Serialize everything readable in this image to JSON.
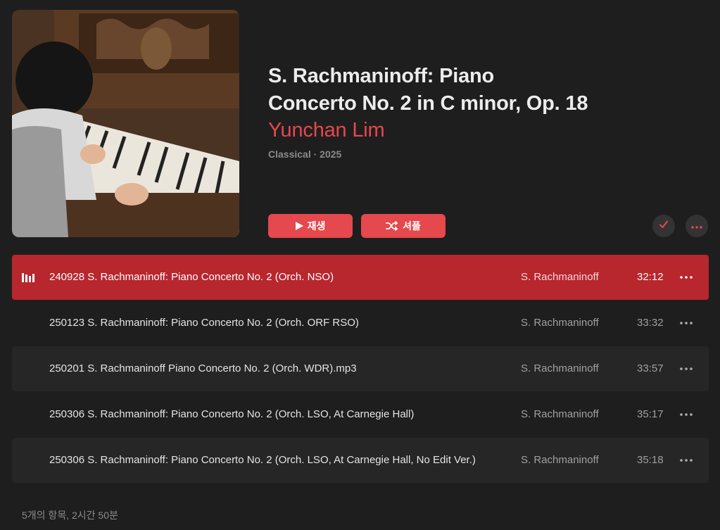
{
  "album": {
    "title_line1": "S. Rachmaninoff: Piano",
    "title_line2": "Concerto No. 2 in C minor, Op. 18",
    "artist": "Yunchan Lim",
    "meta": "Classical · 2025",
    "artwork_icon": "album-artwork-piano-photo"
  },
  "actions": {
    "play_label": "재생",
    "shuffle_label": "셔플",
    "play_icon": "play-icon",
    "shuffle_icon": "shuffle-icon",
    "check_icon": "checkmark-icon",
    "more_icon": "more-icon"
  },
  "tracks": [
    {
      "title": "240928 S. Rachmaninoff: Piano Concerto No. 2 (Orch. NSO)",
      "artist": "S. Rachmaninoff",
      "duration": "32:12",
      "playing": true
    },
    {
      "title": "250123 S. Rachmaninoff: Piano Concerto No. 2 (Orch. ORF RSO)",
      "artist": "S. Rachmaninoff",
      "duration": "33:32",
      "playing": false
    },
    {
      "title": "250201 S. Rachmaninoff Piano Concerto No. 2 (Orch. WDR).mp3",
      "artist": "S. Rachmaninoff",
      "duration": "33:57",
      "playing": false
    },
    {
      "title": "250306 S. Rachmaninoff: Piano Concerto No. 2 (Orch. LSO, At Carnegie Hall)",
      "artist": "S. Rachmaninoff",
      "duration": "35:17",
      "playing": false
    },
    {
      "title": "250306 S. Rachmaninoff: Piano Concerto No. 2 (Orch. LSO, At Carnegie Hall, No Edit Ver.)",
      "artist": "S. Rachmaninoff",
      "duration": "35:18",
      "playing": false
    }
  ],
  "footer": {
    "summary": "5개의 항목, 2시간 50분"
  },
  "colors": {
    "accent": "#e5484d",
    "active_row": "#b8262e",
    "background": "#1e1e1e",
    "alt_row": "#262626"
  }
}
